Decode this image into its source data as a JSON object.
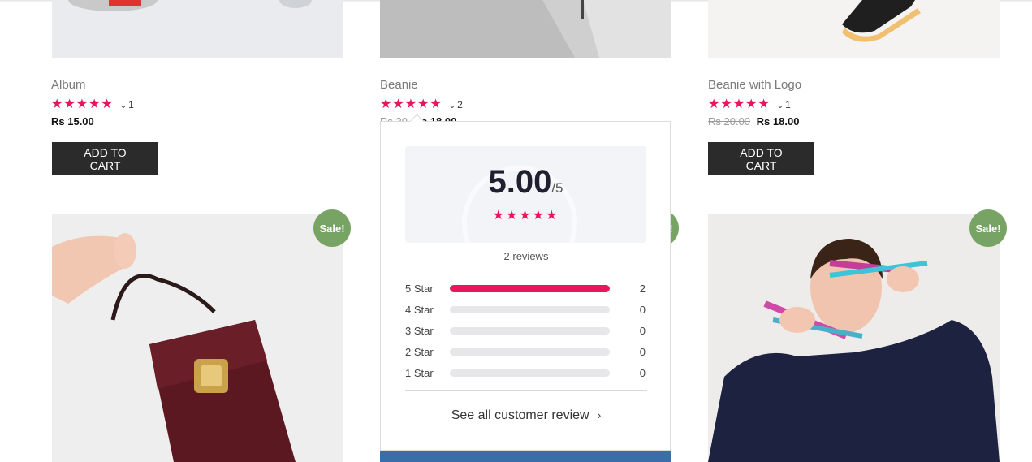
{
  "products_top": [
    {
      "title": "Album",
      "stars": "★★★★★",
      "count": "1",
      "price_old": "",
      "price": "Rs 15.00",
      "button": "ADD TO CART"
    },
    {
      "title": "Beanie",
      "stars": "★★★★★",
      "count": "2",
      "price_old": "Rs 20",
      "price": "Rs 18.00"
    },
    {
      "title": "Beanie with Logo",
      "stars": "★★★★★",
      "count": "1",
      "price_old": "Rs 20.00",
      "price": "Rs 18.00",
      "button": "ADD TO CART"
    }
  ],
  "sale_badge": "Sale!",
  "popup": {
    "score": "5.00",
    "out_of": "/5",
    "stars": "★★★★★",
    "reviews_label": "2 reviews",
    "rows": [
      {
        "label": "5 Star",
        "count": "2",
        "fraction": 1.0
      },
      {
        "label": "4 Star",
        "count": "0",
        "fraction": 0
      },
      {
        "label": "3 Star",
        "count": "0",
        "fraction": 0
      },
      {
        "label": "2 Star",
        "count": "0",
        "fraction": 0
      },
      {
        "label": "1 Star",
        "count": "0",
        "fraction": 0
      }
    ],
    "see_all": "See all customer review"
  },
  "icons": {
    "chevron_down": "⌄",
    "chevron_right": "›"
  },
  "colors": {
    "accent": "#e8175d",
    "sale": "#77a464",
    "button": "#2b2b2b"
  }
}
